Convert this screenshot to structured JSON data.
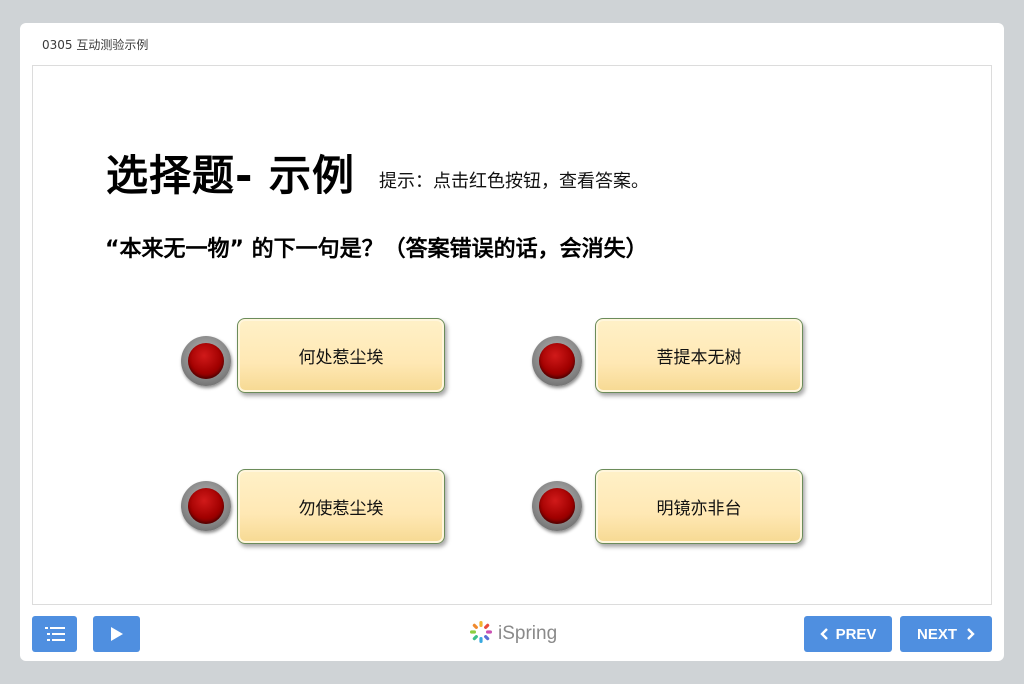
{
  "player": {
    "title": "0305 互动测验示例"
  },
  "slide": {
    "heading": "选择题- 示例",
    "hint": "提示：点击红色按钮，查看答案。",
    "question": "“本来无一物” 的下一句是？（答案错误的话，会消失）",
    "answers": [
      {
        "label": "何处惹尘埃"
      },
      {
        "label": "菩提本无树"
      },
      {
        "label": "勿使惹尘埃"
      },
      {
        "label": "明镜亦非台"
      }
    ]
  },
  "toolbar": {
    "menu_icon": "list-icon",
    "play_icon": "play-icon",
    "brand": "iSpring",
    "prev_label": "PREV",
    "next_label": "NEXT"
  },
  "colors": {
    "accent": "#4f8fe0",
    "answer_fill": "#ffe8b4",
    "answer_border": "#6b8c5a",
    "red_button": "#a10000",
    "background": "#cfd3d6"
  }
}
